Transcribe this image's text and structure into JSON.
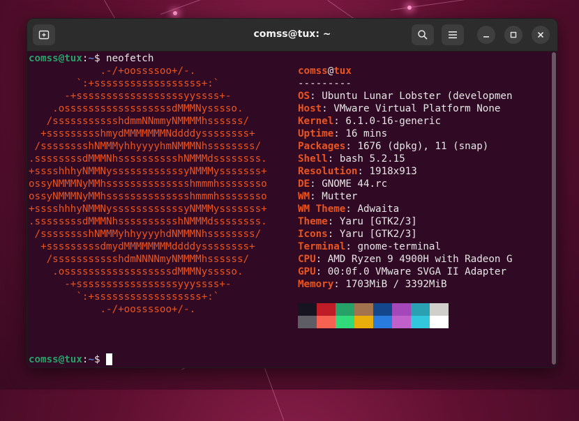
{
  "window": {
    "title": "comss@tux: ~"
  },
  "prompt": {
    "user": "comss@tux",
    "sep": ":",
    "path": "~",
    "symbol": "$",
    "command": " neofetch"
  },
  "art_lines": [
    "            .-/+oossssoo+/-.",
    "        `:+ssssssssssssssssss+:`",
    "      -+ssssssssssssssssssyyssss+-",
    "    .ossssssssssssssssssdMMMNysssso.",
    "   /ssssssssssshdmmNNmmyNMMMMhssssss/",
    "  +ssssssssshmydMMMMMMMNddddyssssssss+",
    " /sssssssshNMMMyhhyyyyhmNMMMNhssssssss/",
    ".ssssssssdMMMNhsssssssssshNMMMdssssssss.",
    "+sssshhhyNMMNyssssssssssssyNMMMysssssss+",
    "ossyNMMMNyMMhsssssssssssssshmmmhssssssso",
    "ossyNMMMNyMMhsssssssssssssshmmmhssssssso",
    "+sssshhhyNMMNyssssssssssssyNMMMysssssss+",
    ".ssssssssdMMMNhsssssssssshNMMMdssssssss.",
    " /sssssssshNMMMyhhyyyyhdNMMMNhssssssss/",
    "  +sssssssssdmydMMMMMMMMddddyssssssss+",
    "   /ssssssssssshdmNNNNmyNMMMMhssssss/",
    "    .ossssssssssssssssssdMMMNysssso.",
    "      -+sssssssssssssssssyyyssss+-",
    "        `:+ssssssssssssssssss+:`",
    "            .-/+oossssoo+/-."
  ],
  "info": {
    "user": "comss",
    "at": "@",
    "host": "tux",
    "underline": "---------",
    "rows": [
      {
        "key": "OS",
        "value": "Ubuntu Lunar Lobster (developmen"
      },
      {
        "key": "Host",
        "value": "VMware Virtual Platform None"
      },
      {
        "key": "Kernel",
        "value": "6.1.0-16-generic"
      },
      {
        "key": "Uptime",
        "value": "16 mins"
      },
      {
        "key": "Packages",
        "value": "1676 (dpkg), 11 (snap)"
      },
      {
        "key": "Shell",
        "value": "bash 5.2.15"
      },
      {
        "key": "Resolution",
        "value": "1918x913"
      },
      {
        "key": "DE",
        "value": "GNOME 44.rc"
      },
      {
        "key": "WM",
        "value": "Mutter"
      },
      {
        "key": "WM Theme",
        "value": "Adwaita"
      },
      {
        "key": "Theme",
        "value": "Yaru [GTK2/3]"
      },
      {
        "key": "Icons",
        "value": "Yaru [GTK2/3]"
      },
      {
        "key": "Terminal",
        "value": "gnome-terminal"
      },
      {
        "key": "CPU",
        "value": "AMD Ryzen 9 4900H with Radeon G"
      },
      {
        "key": "GPU",
        "value": "00:0f.0 VMware SVGA II Adapter"
      },
      {
        "key": "Memory",
        "value": "1703MiB / 3392MiB"
      }
    ],
    "key_sep": ": "
  },
  "palette": {
    "top": [
      "#171421",
      "#c01c28",
      "#26a269",
      "#a2734c",
      "#12488b",
      "#a347ba",
      "#2aa1b3",
      "#d0cfcc"
    ],
    "bottom": [
      "#5e5c64",
      "#f66151",
      "#33da7a",
      "#e9ad0c",
      "#2a7bde",
      "#c061cb",
      "#33c7de",
      "#ffffff"
    ]
  },
  "colors": {
    "terminal_bg": "#300a24",
    "accent": "#e95420",
    "prompt_user": "#26a269",
    "prompt_path": "#5a7fd0"
  },
  "icons": {
    "new_tab": "new-tab-icon",
    "search": "search-icon",
    "menu": "hamburger-menu-icon",
    "minimize": "minimize-icon",
    "maximize": "maximize-icon",
    "close": "close-icon"
  }
}
